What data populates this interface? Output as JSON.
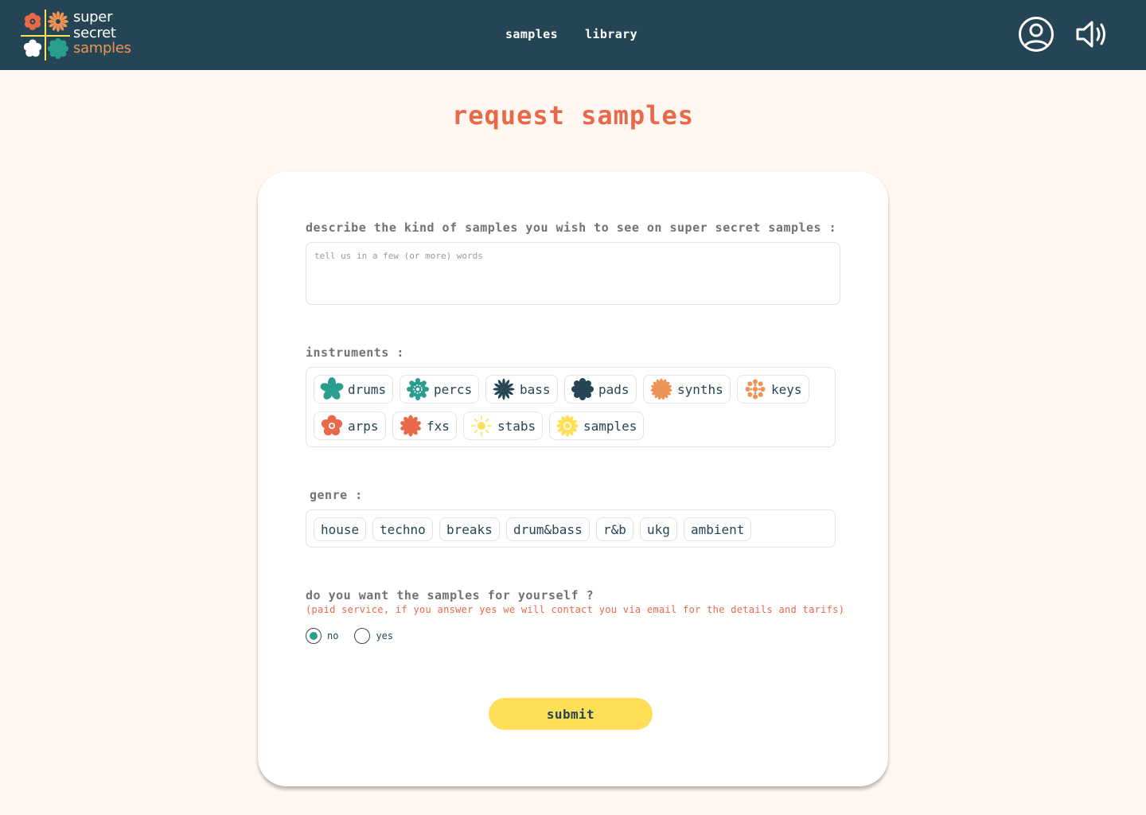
{
  "brand": {
    "line1": "super",
    "line2": "secret",
    "line3": "samples",
    "colors": {
      "navy": "#264554",
      "coral": "#e8684a",
      "orange": "#ee9356",
      "teal": "#2a9d8f",
      "yellow": "#ffdf57",
      "cream": "#fff7f0"
    }
  },
  "nav": {
    "items": [
      {
        "label": "samples"
      },
      {
        "label": "library"
      }
    ],
    "icons": [
      "user-circle-icon",
      "speaker-volume-icon"
    ]
  },
  "page": {
    "title": "request samples"
  },
  "form": {
    "describe": {
      "label": "describe the kind of samples you wish to see on super secret samples :",
      "placeholder": "tell us in a few (or more) words",
      "value": ""
    },
    "instruments": {
      "label": "instruments :",
      "items": [
        {
          "label": "drums",
          "icon": "teal-star-flower-icon"
        },
        {
          "label": "percs",
          "icon": "teal-gear-flower-icon"
        },
        {
          "label": "bass",
          "icon": "navy-burst-flower-icon"
        },
        {
          "label": "pads",
          "icon": "navy-scalloped-flower-icon"
        },
        {
          "label": "synths",
          "icon": "orange-daisy-flower-icon"
        },
        {
          "label": "keys",
          "icon": "orange-dot-flower-icon"
        },
        {
          "label": "arps",
          "icon": "coral-ring-flower-icon"
        },
        {
          "label": "fxs",
          "icon": "coral-star-flower-icon"
        },
        {
          "label": "stabs",
          "icon": "yellow-sun-icon"
        },
        {
          "label": "samples",
          "icon": "yellow-sunflower-icon"
        }
      ]
    },
    "genre": {
      "label": "genre :",
      "items": [
        {
          "label": "house"
        },
        {
          "label": "techno"
        },
        {
          "label": "breaks"
        },
        {
          "label": "drum&bass"
        },
        {
          "label": "r&b"
        },
        {
          "label": "ukg"
        },
        {
          "label": "ambient"
        }
      ]
    },
    "ownership": {
      "question": "do you want the samples for yourself ?",
      "note": "(paid service, if you answer yes we will contact you via email for the details and tarifs)",
      "options": [
        {
          "label": "no",
          "selected": true
        },
        {
          "label": "yes",
          "selected": false
        }
      ]
    },
    "submit_label": "submit"
  }
}
